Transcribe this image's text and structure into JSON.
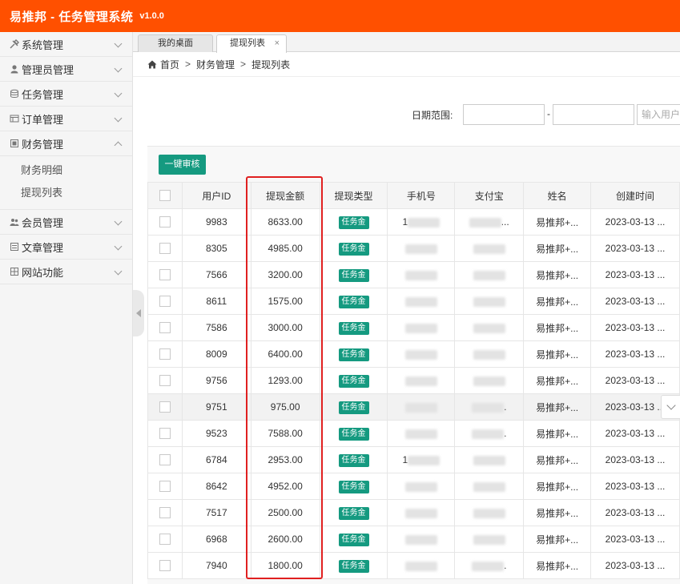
{
  "header": {
    "title": "易推邦 - 任务管理系统",
    "version": "v1.0.0"
  },
  "sidebar": {
    "items": [
      {
        "label": "系统管理",
        "icon": "tools-icon",
        "expanded": false
      },
      {
        "label": "管理员管理",
        "icon": "user-icon",
        "expanded": false
      },
      {
        "label": "任务管理",
        "icon": "database-icon",
        "expanded": false
      },
      {
        "label": "订单管理",
        "icon": "window-icon",
        "expanded": false
      },
      {
        "label": "财务管理",
        "icon": "finance-icon",
        "expanded": true,
        "children": [
          "财务明细",
          "提现列表"
        ]
      },
      {
        "label": "会员管理",
        "icon": "members-icon",
        "expanded": false
      },
      {
        "label": "文章管理",
        "icon": "article-icon",
        "expanded": false
      },
      {
        "label": "网站功能",
        "icon": "site-icon",
        "expanded": false
      }
    ]
  },
  "tabs": [
    {
      "label": "我的桌面",
      "active": false
    },
    {
      "label": "提现列表",
      "active": true,
      "close": "×"
    }
  ],
  "breadcrumb": {
    "home": "首页",
    "sep": ">",
    "level1": "财务管理",
    "level2": "提现列表"
  },
  "filter": {
    "label": "日期范围:",
    "dash": "-",
    "user_placeholder": "输入用户"
  },
  "toolbar": {
    "audit_label": "一键审核"
  },
  "table": {
    "headers": [
      "用户ID",
      "提现金额",
      "提现类型",
      "手机号",
      "支付宝",
      "姓名",
      "创建时间"
    ],
    "type_tag": "任务金",
    "name": "易推邦+...",
    "time": "2023-03-13 ...",
    "rows": [
      {
        "uid": "9983",
        "amount": "8633.00",
        "phone_prefix": "1",
        "alipay_suffix": "..."
      },
      {
        "uid": "8305",
        "amount": "4985.00",
        "phone_prefix": "",
        "alipay_suffix": ""
      },
      {
        "uid": "7566",
        "amount": "3200.00",
        "phone_prefix": "",
        "alipay_suffix": ""
      },
      {
        "uid": "8611",
        "amount": "1575.00",
        "phone_prefix": "",
        "alipay_suffix": ""
      },
      {
        "uid": "7586",
        "amount": "3000.00",
        "phone_prefix": "",
        "alipay_suffix": ""
      },
      {
        "uid": "8009",
        "amount": "6400.00",
        "phone_prefix": "",
        "alipay_suffix": ""
      },
      {
        "uid": "9756",
        "amount": "1293.00",
        "phone_prefix": "",
        "alipay_suffix": ""
      },
      {
        "uid": "9751",
        "amount": "975.00",
        "phone_prefix": "",
        "alipay_suffix": "."
      },
      {
        "uid": "9523",
        "amount": "7588.00",
        "phone_prefix": "",
        "alipay_suffix": "."
      },
      {
        "uid": "6784",
        "amount": "2953.00",
        "phone_prefix": "1",
        "alipay_suffix": ""
      },
      {
        "uid": "8642",
        "amount": "4952.00",
        "phone_prefix": "",
        "alipay_suffix": ""
      },
      {
        "uid": "7517",
        "amount": "2500.00",
        "phone_prefix": "",
        "alipay_suffix": ""
      },
      {
        "uid": "6968",
        "amount": "2600.00",
        "phone_prefix": "",
        "alipay_suffix": ""
      },
      {
        "uid": "7940",
        "amount": "1800.00",
        "phone_prefix": "",
        "alipay_suffix": "."
      }
    ]
  },
  "colors": {
    "header_bg": "#ff5000",
    "accent_green": "#159a80",
    "highlight_red": "#e02020"
  }
}
